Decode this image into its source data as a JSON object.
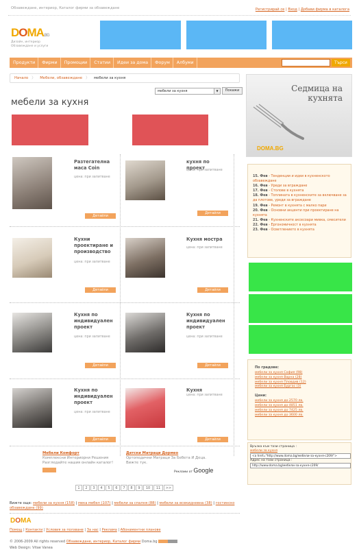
{
  "header": {
    "tagline": "Обзавеждане, интериор, Каталог фирми за обзавеждане",
    "links": [
      "Регистрирай се",
      "Вход",
      "Добави фирма в каталога"
    ],
    "logo": {
      "text_a": "D",
      "text_o": "O",
      "text_b": "MA",
      "tld": ".BG",
      "sub1": "Дизайн, интериор",
      "sub2": "Обзавеждане и услуги"
    }
  },
  "nav": {
    "items": [
      "Продукти",
      "Фирми",
      "Промоции",
      "Статии",
      "Идеи за дома",
      "Форум",
      "Албуми"
    ],
    "search_button": "Търси"
  },
  "breadcrumb": [
    "Начало",
    "Мебели, обзавеждане",
    "мебели за кухня"
  ],
  "filter": {
    "selected": "мебели за кухня",
    "arrow": "▼",
    "show_button": "Покажи"
  },
  "page_title": "мебели за кухня",
  "products": [
    {
      "name": "Разтегателна маса Coin",
      "price": "цена: при запитване",
      "details": "Детайли"
    },
    {
      "name": "кухня по проект",
      "price": "цена: при запитване",
      "details": "Детайли"
    },
    {
      "name": "Кухни проектиране и производство",
      "price": "цена: при запитване",
      "details": "Детайли"
    },
    {
      "name": "Кухня мостра",
      "price": "цена: при запитване",
      "details": "Детайли"
    },
    {
      "name": "Кухня по индивидуален проект",
      "price": "цена: при запитване",
      "details": "Детайли"
    },
    {
      "name": "Кухня по индивидуален проект",
      "price": "цена: при запитване",
      "details": "Детайли"
    },
    {
      "name": "Кухня по индивидуален проект",
      "price": "цена: при запитване",
      "details": "Детайли"
    },
    {
      "name": "Кухня",
      "price": "цена: при запитване",
      "details": "Детайли"
    }
  ],
  "ads_text": [
    {
      "title": "Мебели Комфорт",
      "line1": "Комплексни Интериорни Решения",
      "line2": "Разгледайте нашия онлайн каталог!"
    },
    {
      "title": "Детски Матраци Дормео",
      "line1": "Ортопедични Матраци За Бебета И Деца.",
      "line2": "Вижте тук."
    }
  ],
  "adchoice": "Реклами от",
  "google": "Google",
  "pager": {
    "pages": [
      "1",
      "2",
      "3",
      "4",
      "5",
      "6",
      "7",
      "8",
      "9",
      "10",
      "11"
    ],
    "next": ">>"
  },
  "see_also": {
    "label": "Вижте още:",
    "links": [
      "мебели за кухня (158)",
      "мека мебел (107)",
      "мебели за спалня (88)",
      "мебели за всекидневна (38)",
      "гостинско обзавеждане (99)"
    ]
  },
  "footer": {
    "links": [
      "Помощ",
      "Контакти",
      "Условия за ползване",
      "За нас",
      "Реклама",
      "Абонаментни планове"
    ],
    "copyright": "© 2006-2009 All rights reserved",
    "copyright_links": [
      "Обзавеждане, интериор, Каталог фирми"
    ],
    "site": "Doma.bg",
    "webdesign": "Web Design: Vitae Vanea"
  },
  "sidebar": {
    "promo_title": "Седмица на кухнята",
    "promo_brand": "DOMA.BG",
    "events": [
      {
        "date": "15. Фев",
        "text": "Тенденции и идеи в кухненското обзавеждане"
      },
      {
        "date": "16. Фев",
        "text": "Уреди за вграждане"
      },
      {
        "date": "17. Фев",
        "text": "Столове в кухнята"
      },
      {
        "date": "18. Фев",
        "text": "Топлината в кухненските за включване за да плотове, уреди за вграждане"
      },
      {
        "date": "19. Фев",
        "text": "Ремонт в кухнята с малко пари"
      },
      {
        "date": "20. Фев",
        "text": "Основни акценти при проектиране на кухнята"
      },
      {
        "date": "21. Фев",
        "text": "Кухненските аксесоари мивка, смесители"
      },
      {
        "date": "22. Фев",
        "text": "Ергономичност в кухнята"
      },
      {
        "date": "23. Фев",
        "text": "Осветлението в кухнята"
      }
    ],
    "filters": {
      "cities_title": "По градове:",
      "cities": [
        "мебели за кухня София (98)",
        "мебели за кухня Варна (28)",
        "мебели за кухня Пловдив (12)",
        "мебели за кухня Бургас (3)"
      ],
      "prices_title": "Цени:",
      "prices": [
        "мебели за кухня до 2570 лв.",
        "мебели за кухня до 4851 лв.",
        "мебели за кухня до 7425 лв.",
        "мебели за кухня до 3600 лв."
      ]
    },
    "link_to_page": "Връзка към тази страница :",
    "link_text": "мебели за кухня",
    "link_code": "<a href=\"http://www.doma.bg/мебели-за-кухня-c209/\">",
    "address_label": "Адрес на тази страница :",
    "address_value": "http://www.doma.bg/мебели-за-кухня-c209/"
  },
  "colors": {
    "accent": "#f2a35c",
    "link": "#d4601b",
    "ad_blue": "#5bb7f5",
    "ad_red": "#e05357",
    "ad_green": "#38e548"
  }
}
